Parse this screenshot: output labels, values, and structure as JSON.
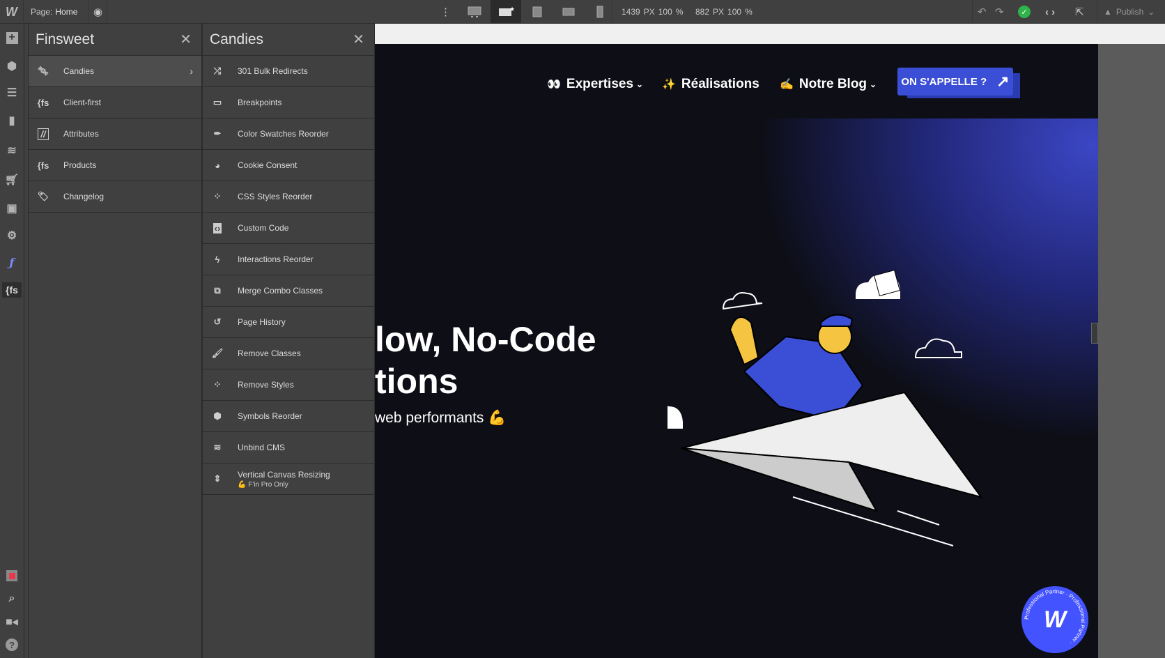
{
  "topbar": {
    "logo": "W",
    "page_label": "Page:",
    "page_name": "Home",
    "width_px": "1439",
    "width_unit": "PX",
    "width_pct": "100",
    "height_px": "882",
    "height_unit": "PX",
    "height_pct": "100",
    "pct": "%",
    "publish": "Publish",
    "status_color": "#2fb34a"
  },
  "rail": {
    "icons": [
      "add-icon",
      "cube-icon",
      "navigator-icon",
      "pages-icon",
      "cms-icon",
      "ecommerce-icon",
      "assets-icon",
      "settings-icon",
      "finsweet-f-icon",
      "finsweet-fs-icon"
    ],
    "bottom_icons": [
      "record-icon",
      "search-icon",
      "video-icon",
      "help-icon"
    ]
  },
  "finsweet": {
    "title": "Finsweet",
    "items": [
      {
        "label": "Candies",
        "icon": "candy-icon"
      },
      {
        "label": "Client-first",
        "icon": "fs-icon"
      },
      {
        "label": "Attributes",
        "icon": "attributes-icon"
      },
      {
        "label": "Products",
        "icon": "fs-icon"
      },
      {
        "label": "Changelog",
        "icon": "tags-icon"
      }
    ]
  },
  "candies": {
    "title": "Candies",
    "items": [
      {
        "label": "301 Bulk Redirects",
        "icon": "shuffle-icon"
      },
      {
        "label": "Breakpoints",
        "icon": "monitor-icon"
      },
      {
        "label": "Color Swatches Reorder",
        "icon": "eyedropper-icon"
      },
      {
        "label": "Cookie Consent",
        "icon": "cookie-icon"
      },
      {
        "label": "CSS Styles Reorder",
        "icon": "drops-icon"
      },
      {
        "label": "Custom Code",
        "icon": "code-icon"
      },
      {
        "label": "Interactions Reorder",
        "icon": "bolt-icon"
      },
      {
        "label": "Merge Combo Classes",
        "icon": "merge-icon"
      },
      {
        "label": "Page History",
        "icon": "history-icon"
      },
      {
        "label": "Remove Classes",
        "icon": "broom-icon"
      },
      {
        "label": "Remove Styles",
        "icon": "drops-remove-icon"
      },
      {
        "label": "Symbols Reorder",
        "icon": "cube-icon"
      },
      {
        "label": "Unbind CMS",
        "icon": "database-icon"
      },
      {
        "label": "Vertical Canvas Resizing",
        "sub": "💪 F'in Pro Only",
        "icon": "vertical-resize-icon"
      }
    ]
  },
  "site": {
    "nav": [
      {
        "emoji": "👀",
        "label": "Expertises"
      },
      {
        "emoji": "✨",
        "label": "Réalisations"
      },
      {
        "emoji": "✍️",
        "label": "Notre Blog"
      }
    ],
    "cta": "ON S'APPELLE ?",
    "headline_1": "low, No-Code",
    "headline_2": "tions",
    "subtitle": "web performants 💪",
    "badge_text": "Professional Partner · Professional Partner ·",
    "badge_logo": "W",
    "accent": "#3b4fd6"
  }
}
